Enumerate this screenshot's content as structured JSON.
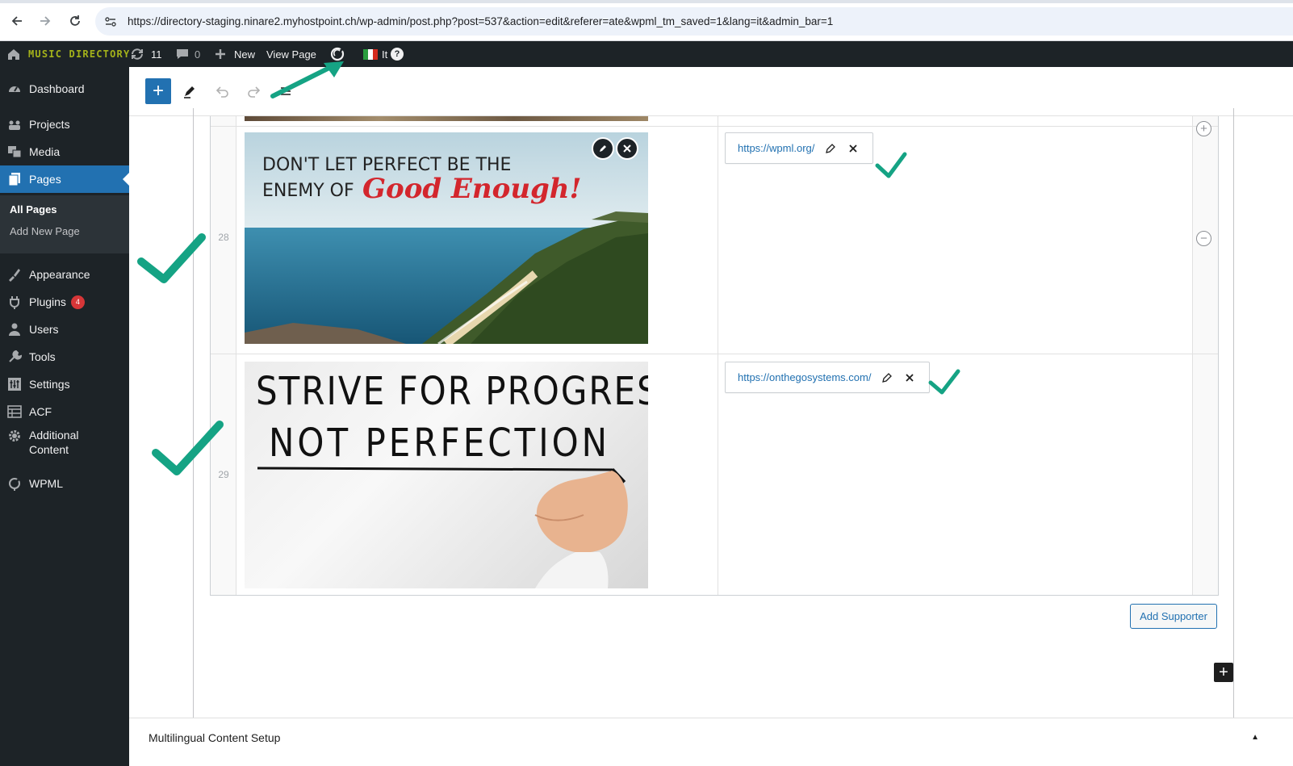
{
  "browser": {
    "url": "https://directory-staging.ninare2.myhostpoint.ch/wp-admin/post.php?post=537&action=edit&referer=ate&wpml_tm_saved=1&lang=it&admin_bar=1",
    "back_icon": "back-arrow-icon",
    "forward_icon": "forward-arrow-icon",
    "reload_icon": "reload-icon"
  },
  "admin_bar": {
    "site_name": "MUSIC DIRECTORY",
    "updates_count": "11",
    "comments_count": "0",
    "new_label": "New",
    "view_page_label": "View Page",
    "language_label": "It",
    "help_glyph": "?"
  },
  "sidebar": {
    "items": [
      {
        "label": "Dashboard",
        "icon": "dashboard-icon"
      },
      {
        "label": "Projects",
        "icon": "projects-icon"
      },
      {
        "label": "Media",
        "icon": "media-icon"
      },
      {
        "label": "Pages",
        "icon": "pages-icon"
      },
      {
        "label": "Appearance",
        "icon": "appearance-icon"
      },
      {
        "label": "Plugins",
        "icon": "plugins-icon",
        "badge": "4"
      },
      {
        "label": "Users",
        "icon": "users-icon"
      },
      {
        "label": "Tools",
        "icon": "tools-icon"
      },
      {
        "label": "Settings",
        "icon": "settings-icon"
      },
      {
        "label": "ACF",
        "icon": "acf-icon"
      },
      {
        "label": "Additional",
        "label2": "Content",
        "icon": "gear-icon"
      },
      {
        "label": "WPML",
        "icon": "wpml-icon"
      }
    ],
    "submenu": {
      "all_pages": "All Pages",
      "add_new_page": "Add New Page"
    }
  },
  "toolbar": {
    "add_block_glyph": "+",
    "tools_icon": "pencil-icon",
    "undo_icon": "undo-icon",
    "redo_icon": "redo-icon",
    "outline_icon": "list-view-icon"
  },
  "repeater": {
    "rows": [
      {
        "number": "28",
        "image_caption_line1": "DON'T LET PERFECT BE THE",
        "image_caption_line2": "ENEMY OF",
        "image_caption_script": "Good Enough!",
        "link_url": "https://wpml.org/"
      },
      {
        "number": "29",
        "image_caption_line1": "STRIVE FOR PROGRESS,",
        "image_caption_line2": "NOT PERFECTION",
        "link_url": "https://onthegosystems.com/"
      }
    ],
    "add_row_glyph": "+",
    "remove_row_glyph": "−",
    "add_supporter_label": "Add Supporter"
  },
  "block_inserter_glyph": "+",
  "multilingual_panel": {
    "title": "Multilingual Content Setup",
    "caret": "▲"
  },
  "colors": {
    "admin_bg": "#1d2327",
    "accent": "#2271b1",
    "site_name": "#a4b21a",
    "annotation": "#15a384"
  }
}
